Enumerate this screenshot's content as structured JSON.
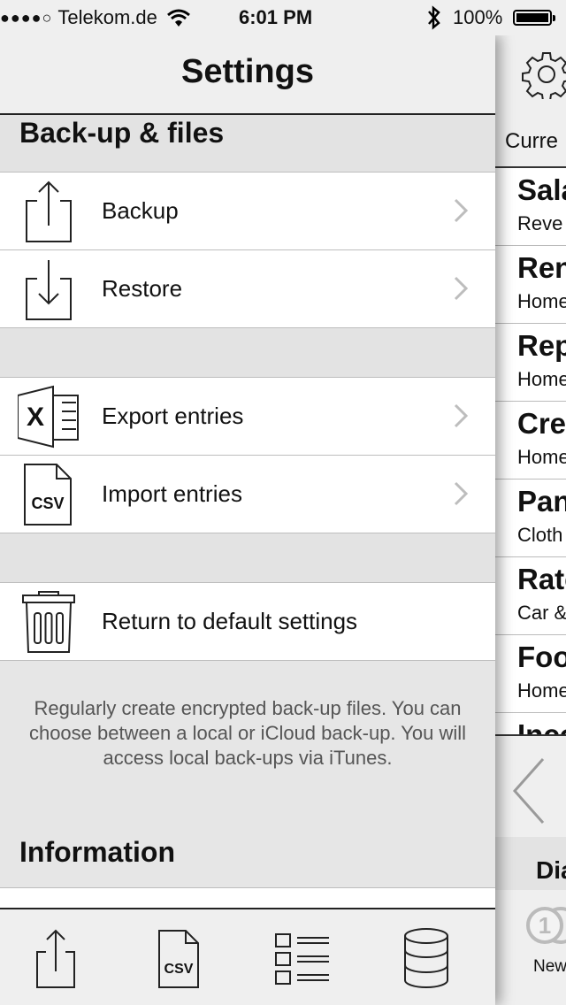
{
  "status_bar": {
    "signal": "●●●●○",
    "carrier": "Telekom.de",
    "time": "6:01 PM",
    "battery_percent": "100%"
  },
  "navbar": {
    "title": "Settings"
  },
  "sections": {
    "backup": {
      "title": "Back-up & files",
      "items": [
        {
          "label": "Backup",
          "icon": "upload-icon"
        },
        {
          "label": "Restore",
          "icon": "download-icon"
        },
        {
          "label": "Export entries",
          "icon": "excel-icon"
        },
        {
          "label": "Import entries",
          "icon": "csv-file-icon"
        },
        {
          "label": "Return to default settings",
          "icon": "trash-icon"
        }
      ],
      "footer": "Regularly create encrypted back-up files. You can choose between a local or iCloud back-up. You will access local back-ups via iTunes."
    },
    "information": {
      "title": "Information"
    }
  },
  "tab_bar": {
    "tabs": [
      {
        "icon": "share-icon"
      },
      {
        "icon": "csv-file-icon"
      },
      {
        "icon": "categories-list-icon"
      },
      {
        "icon": "database-icon"
      }
    ]
  },
  "right_panel": {
    "header_label": "Curre",
    "entries": [
      {
        "title": "Sala",
        "subtitle": "Reve"
      },
      {
        "title": "Ren",
        "subtitle": "Home"
      },
      {
        "title": "Rep",
        "subtitle": "Home"
      },
      {
        "title": "Cre",
        "subtitle": "Home"
      },
      {
        "title": "Pan",
        "subtitle": "Cloth"
      },
      {
        "title": "Rate",
        "subtitle": "Car &"
      },
      {
        "title": "Foo",
        "subtitle": "Home"
      },
      {
        "title": "Inco",
        "subtitle": ""
      }
    ],
    "bottom_label": "Dia",
    "badge": "1",
    "new_label": "New"
  }
}
